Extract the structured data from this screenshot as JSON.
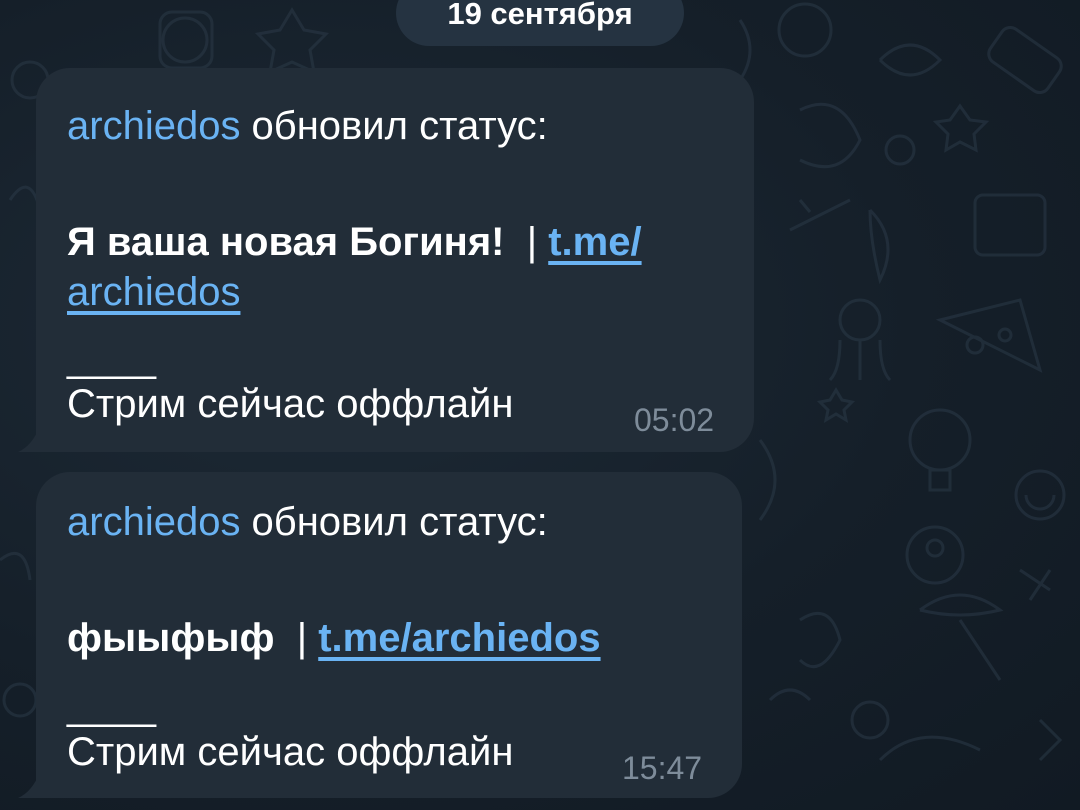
{
  "date_separator": "19 сентября",
  "messages": [
    {
      "author": "archiedos",
      "action": " обновил статус:",
      "status_text": "Я ваша новая Богиня!",
      "separator": "|",
      "link_part1": "t.me/",
      "link_part2": "archiedos",
      "divider": "____",
      "stream_status": "Стрим сейчас оффлайн",
      "time": "05:02"
    },
    {
      "author": "archiedos",
      "action": " обновил статус:",
      "status_text": "фыыфыф",
      "separator": "|",
      "link": "t.me/archiedos",
      "divider": "____",
      "stream_status": "Стрим сейчас оффлайн",
      "time": "15:47"
    }
  ],
  "colors": {
    "background": "#151f29",
    "bubble": "#222d38",
    "date_pill": "#253341",
    "link": "#6ab3f3",
    "time": "#7e8c9a",
    "text": "#ffffff"
  }
}
